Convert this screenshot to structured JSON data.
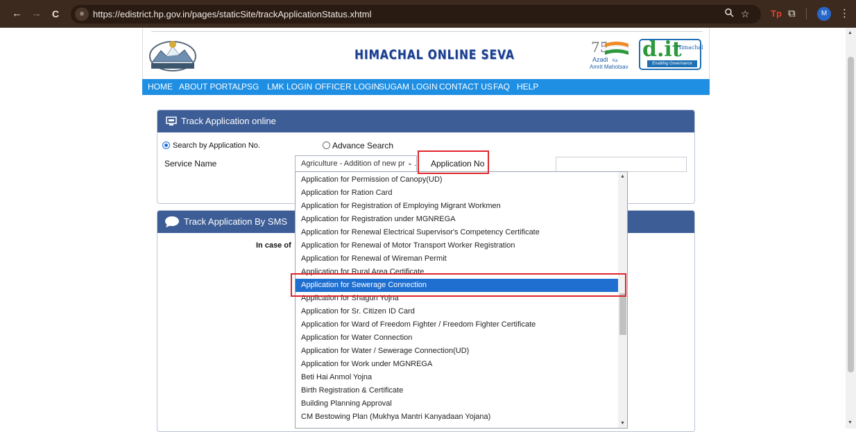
{
  "browser": {
    "back": "←",
    "forward": "→",
    "reload": "C",
    "site_icon": "≡",
    "url": "https://edistrict.hp.gov.in/pages/staticSite/trackApplicationStatus.xhtml",
    "zoom_icon": "🔍",
    "star_icon": "☆",
    "ext_label": "Tp",
    "puzzle_icon": "⧉",
    "profile_initial": "M",
    "menu_icon": "⋮"
  },
  "header": {
    "site_title": "HIMACHAL ONLINE SEVA",
    "azadi_line1": "Azadi",
    "azadi_ka": "Ka",
    "azadi_line2": "Amrit Mahotsav",
    "dit_text": "d.it",
    "dit_himachal": "Himachal",
    "dit_tagline": "Enabling Governance"
  },
  "nav": {
    "items": [
      "HOME",
      "ABOUT PORTAL",
      "PSG",
      "LMK LOGIN",
      "OFFICER LOGIN",
      "SUGAM LOGIN",
      "CONTACT US",
      "FAQ",
      "HELP"
    ]
  },
  "track_panel": {
    "title": "Track Application online",
    "radio_app_no": "Search by Application No.",
    "radio_advance": "Advance Search",
    "service_label": "Service Name",
    "service_selected": "Agriculture - Addition of new product & Flavour in Existing Licence",
    "app_no_label": "Application No"
  },
  "sms_panel": {
    "title": "Track Application By SMS",
    "text": "In case of"
  },
  "dropdown": {
    "options": [
      "Application for Permission of Canopy(UD)",
      "Application for Ration Card",
      "Application for Registration of Employing Migrant Workmen",
      "Application for Registration under MGNREGA",
      "Application for Renewal Electrical Supervisor's Competency Certificate",
      "Application for Renewal of Motor Transport Worker Registration",
      "Application for Renewal of Wireman Permit",
      "Application for Rural Area Certificate",
      "Application for Sewerage Connection",
      "Application for Shagun Yojna",
      "Application for Sr. Citizen ID Card",
      "Application for Ward of Freedom Fighter / Freedom Fighter Certificate",
      "Application for Water Connection",
      "Application for Water / Sewerage Connection(UD)",
      "Application for Work under MGNREGA",
      "Beti Hai Anmol Yojna",
      "Birth Registration & Certificate",
      "Building Planning Approval",
      "CM Bestowing Plan (Mukhya Mantri Kanyadaan Yojana)"
    ],
    "selected_index": 8
  }
}
